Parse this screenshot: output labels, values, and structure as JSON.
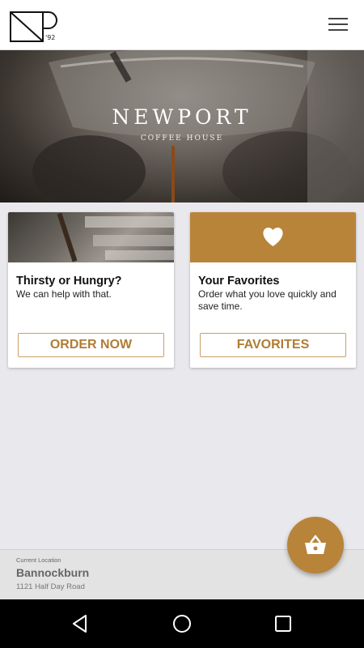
{
  "header": {
    "logo_year": "'92",
    "icons": {
      "logo": "np-logo",
      "menu": "hamburger-menu-icon"
    }
  },
  "hero": {
    "title": "NEWPORT",
    "subtitle": "COFFEE HOUSE"
  },
  "cards": [
    {
      "title": "Thirsty or Hungry?",
      "text": "We can help with that.",
      "button": "ORDER NOW",
      "image": "espresso-photo"
    },
    {
      "title": "Your Favorites",
      "text": "Order what you love quickly and save time.",
      "button": "FAVORITES",
      "image": "heart-icon"
    }
  ],
  "location": {
    "label": "Current Location",
    "name": "Bannockburn",
    "address": "1121 Half Day Road"
  },
  "cart": {
    "icon": "basket-icon"
  },
  "system_nav": {
    "icons": [
      "back-icon",
      "home-icon",
      "recents-icon"
    ]
  },
  "colors": {
    "accent": "#b8843a",
    "button_text": "#b07c34",
    "background": "#e9e8ed"
  }
}
